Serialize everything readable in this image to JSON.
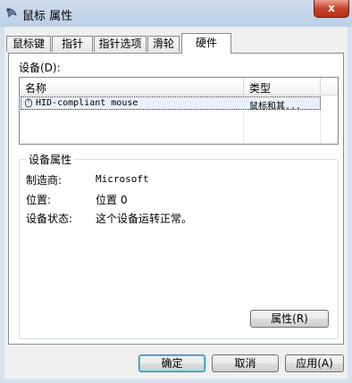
{
  "window": {
    "title": "鼠标 属性",
    "close_label": "x"
  },
  "tabs": [
    {
      "label": "鼠标键"
    },
    {
      "label": "指针"
    },
    {
      "label": "指针选项"
    },
    {
      "label": "滑轮"
    },
    {
      "label": "硬件",
      "active": true
    }
  ],
  "devices": {
    "label": "设备(D):",
    "columns": [
      "名称",
      "类型"
    ],
    "rows": [
      {
        "name": "HID-compliant mouse",
        "type": "鼠标和其...",
        "icon": "mouse-icon"
      }
    ]
  },
  "properties": {
    "title": "设备属性",
    "items": [
      {
        "key": "制造商:",
        "value": "Microsoft"
      },
      {
        "key": "位置:",
        "value": "位置 0"
      },
      {
        "key": "设备状态:",
        "value": "这个设备运转正常。"
      }
    ],
    "button_label": "属性(R)"
  },
  "footer": {
    "ok_label": "确定",
    "cancel_label": "取消",
    "apply_label": "应用(A)"
  },
  "colors": {
    "title_bar": "#bcd0e6",
    "close_button": "#c7442c",
    "selection": "#e8f1fb"
  }
}
